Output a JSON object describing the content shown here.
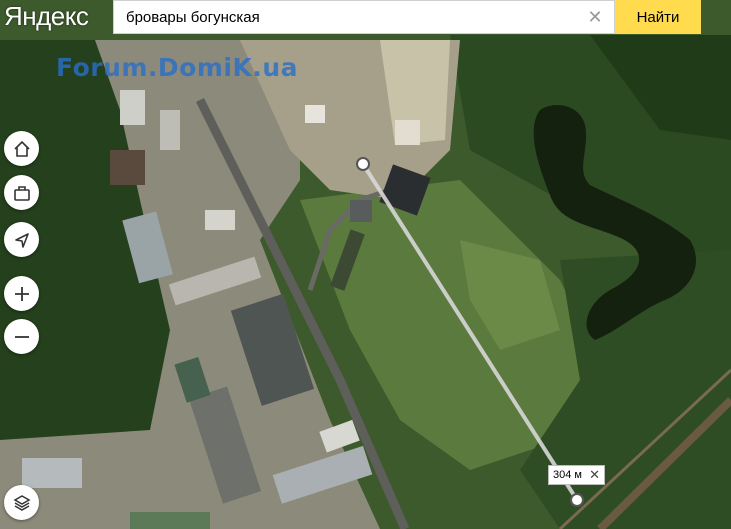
{
  "header": {
    "logo": "Яндекс",
    "search_value": "бровары богунская",
    "search_button": "Найти"
  },
  "map": {
    "watermark": "Forum.DomiK.ua",
    "ruler_label": "304 м"
  },
  "controls": {
    "home": "home-icon",
    "briefcase": "briefcase-icon",
    "locate": "locate-icon",
    "zoom_in": "plus-icon",
    "zoom_out": "minus-icon",
    "layers": "layers-icon"
  },
  "colors": {
    "button_yellow": "#ffdb4d",
    "ruler_line": "#d8d8d8"
  }
}
